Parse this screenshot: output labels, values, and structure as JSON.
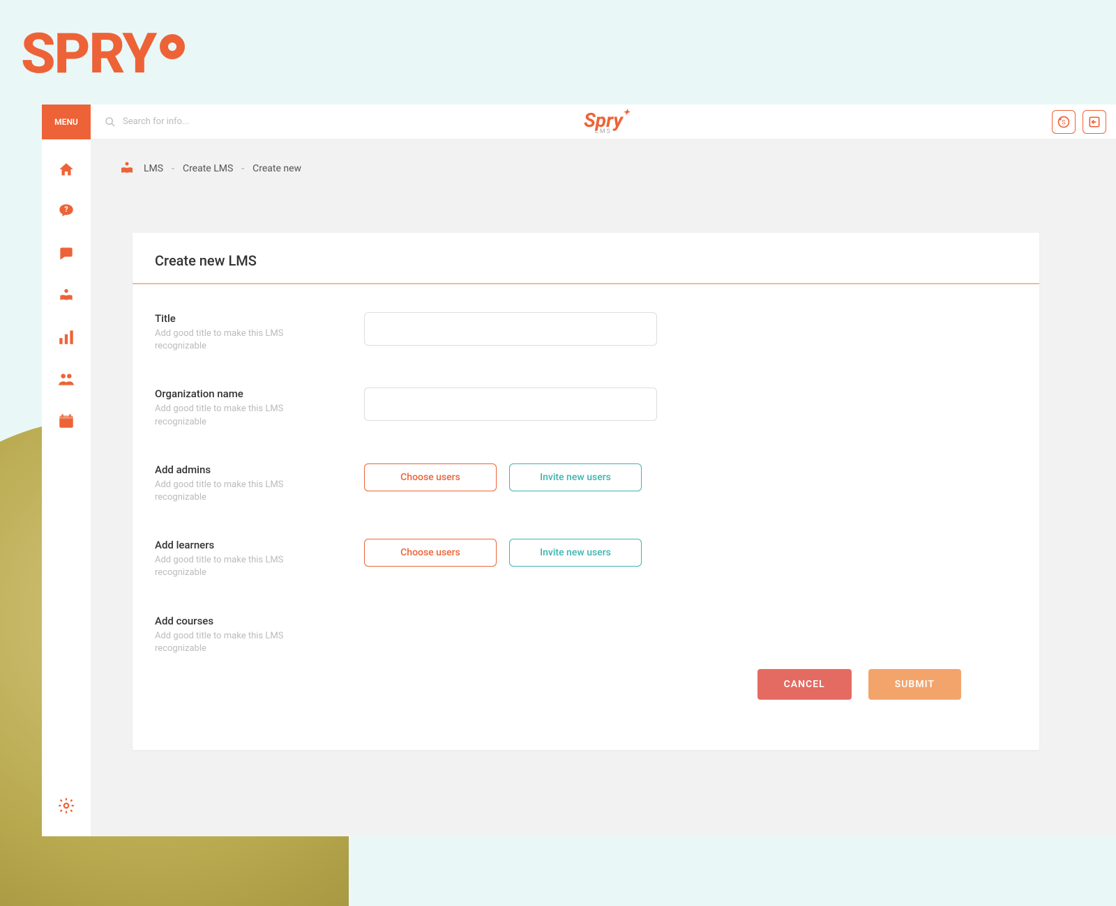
{
  "brand": {
    "name": "SPRY",
    "center_name": "Spry",
    "center_sub": "LMS"
  },
  "topbar": {
    "menu_label": "MENU",
    "search_placeholder": "Search for info..."
  },
  "breadcrumb": {
    "root": "LMS",
    "mid": "Create LMS",
    "leaf": "Create new"
  },
  "card": {
    "title": "Create new LMS"
  },
  "form": {
    "title": {
      "label": "Title",
      "help": "Add good title to make this LMS recognizable"
    },
    "org": {
      "label": "Organization name",
      "help": "Add good title to make this LMS recognizable"
    },
    "admins": {
      "label": "Add admins",
      "help": "Add good title to make this LMS recognizable",
      "choose": "Choose users",
      "invite": "Invite new users"
    },
    "learners": {
      "label": "Add learners",
      "help": "Add good title to make this LMS recognizable",
      "choose": "Choose users",
      "invite": "Invite new users"
    },
    "courses": {
      "label": "Add courses",
      "help": "Add good title to make this LMS recognizable"
    }
  },
  "actions": {
    "cancel": "CANCEL",
    "submit": "SUBMIT"
  },
  "colors": {
    "primary": "#ed6337",
    "teal": "#3bb5b0",
    "cancel": "#e46b61",
    "submit": "#f3a46b"
  }
}
